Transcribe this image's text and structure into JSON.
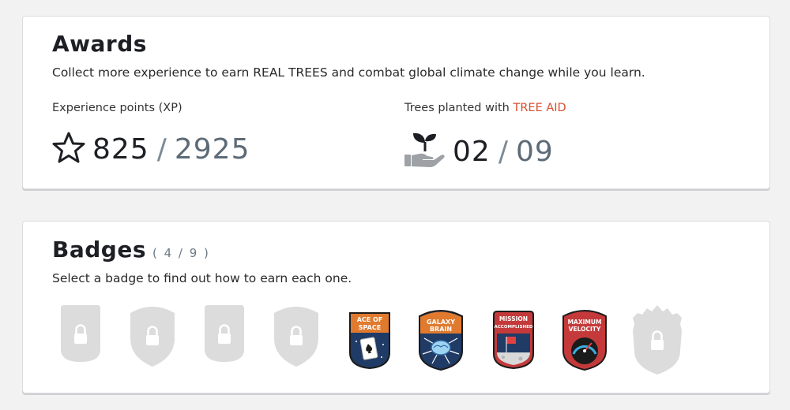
{
  "awards": {
    "title": "Awards",
    "subtitle": "Collect more experience to earn REAL TREES and combat global climate change while you learn.",
    "xp": {
      "label": "Experience points (XP)",
      "current": "825",
      "separator": "/",
      "total": "2925",
      "icon": "star-outline-icon"
    },
    "trees": {
      "label_prefix": "Trees planted with ",
      "label_link": "TREE AID",
      "current": "02",
      "separator": "/",
      "total": "09",
      "icon": "hand-sprout-icon"
    }
  },
  "badges": {
    "title": "Badges",
    "count": "( 4 / 9 )",
    "subtitle": "Select a badge to find out how to earn each one.",
    "items": [
      {
        "state": "locked"
      },
      {
        "state": "locked"
      },
      {
        "state": "locked"
      },
      {
        "state": "locked"
      },
      {
        "state": "earned",
        "label": [
          "ACE OF",
          "SPACE"
        ]
      },
      {
        "state": "earned",
        "label": [
          "GALAXY",
          "BRAIN"
        ]
      },
      {
        "state": "earned",
        "label": [
          "MISSION",
          "ACCOMPLISHED"
        ]
      },
      {
        "state": "earned",
        "label": [
          "MAXIMUM",
          "VELOCITY"
        ]
      },
      {
        "state": "locked"
      }
    ]
  },
  "colors": {
    "link": "#d8502e",
    "locked_badge": "#dcdcdc",
    "accent_navy": "#1f3b66"
  }
}
